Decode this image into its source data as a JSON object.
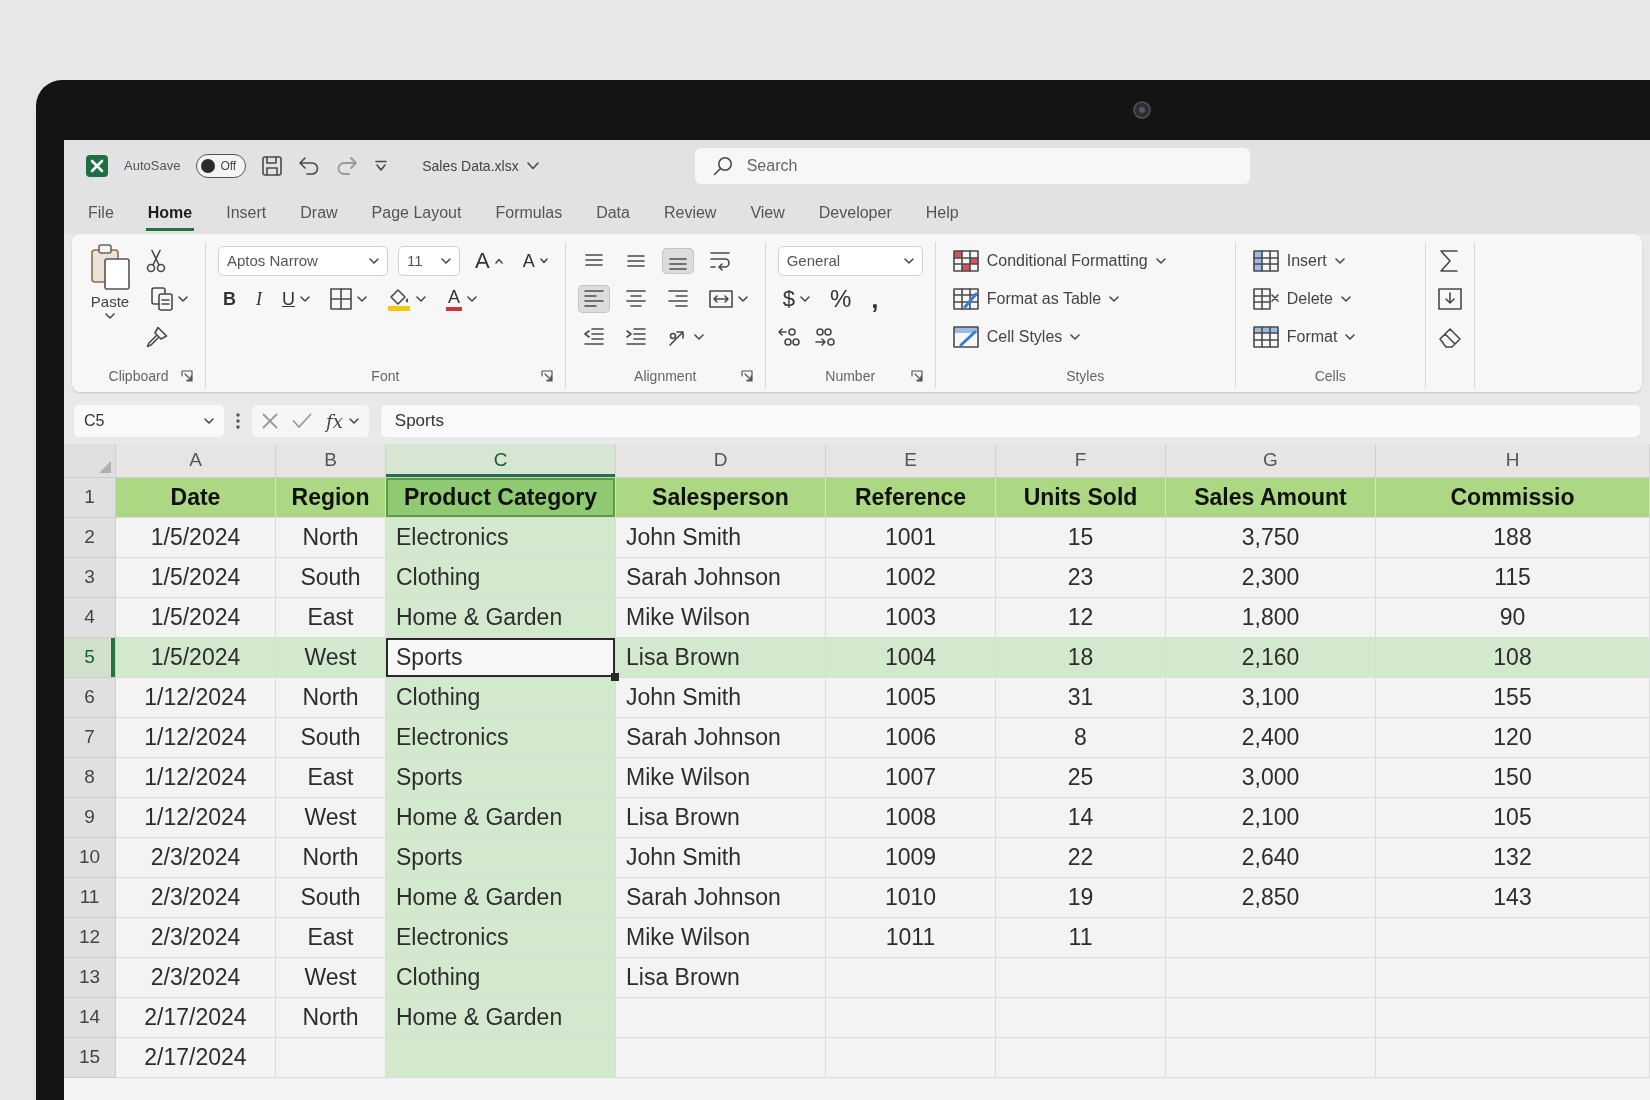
{
  "title_bar": {
    "autosave_label": "AutoSave",
    "autosave": {
      "on": false,
      "label": "Off"
    },
    "file_name": "Sales Data.xlsx",
    "search": {
      "placeholder": "Search"
    }
  },
  "tabs": [
    {
      "label": "File",
      "selected": false
    },
    {
      "label": "Home",
      "selected": true
    },
    {
      "label": "Insert",
      "selected": false
    },
    {
      "label": "Draw",
      "selected": false
    },
    {
      "label": "Page Layout",
      "selected": false
    },
    {
      "label": "Formulas",
      "selected": false
    },
    {
      "label": "Data",
      "selected": false
    },
    {
      "label": "Review",
      "selected": false
    },
    {
      "label": "View",
      "selected": false
    },
    {
      "label": "Developer",
      "selected": false
    },
    {
      "label": "Help",
      "selected": false
    }
  ],
  "ribbon": {
    "clipboard": {
      "label": "Clipboard",
      "paste": "Paste"
    },
    "font": {
      "label": "Font",
      "font_name": "Aptos Narrow",
      "font_size": "11",
      "grow": "A",
      "shrink": "A",
      "bold": "B",
      "italic": "I",
      "underline": "U",
      "font_color": "A"
    },
    "alignment": {
      "label": "Alignment",
      "rows": [
        [
          {
            "kind": "top",
            "selected": false
          },
          {
            "kind": "middle",
            "selected": false
          },
          {
            "kind": "bottom",
            "selected": true
          },
          {
            "kind": "wrap",
            "selected": false
          }
        ],
        [
          {
            "kind": "left",
            "selected": true
          },
          {
            "kind": "center",
            "selected": false
          },
          {
            "kind": "right",
            "selected": false
          },
          {
            "kind": "merge",
            "selected": false
          }
        ],
        [
          {
            "kind": "outdent",
            "selected": false
          },
          {
            "kind": "indent",
            "selected": false
          },
          {
            "kind": "orientation",
            "selected": false
          }
        ]
      ]
    },
    "number": {
      "label": "Number",
      "format": "General",
      "currency": "$",
      "percent": "%",
      "comma": ","
    },
    "styles": {
      "label": "Styles",
      "items": [
        {
          "kind": "conditional",
          "label": "Conditional Formatting"
        },
        {
          "kind": "table",
          "label": "Format as Table"
        },
        {
          "kind": "cell",
          "label": "Cell Styles"
        }
      ]
    },
    "cells": {
      "label": "Cells",
      "items": [
        {
          "kind": "insert",
          "label": "Insert"
        },
        {
          "kind": "delete",
          "label": "Delete"
        },
        {
          "kind": "format",
          "label": "Format"
        }
      ]
    }
  },
  "formula_bar": {
    "name_box": "C5",
    "function_button": "fx",
    "formula": "Sports"
  },
  "sheet": {
    "columns": [
      {
        "letter": "A",
        "selected": false
      },
      {
        "letter": "B",
        "selected": false
      },
      {
        "letter": "C",
        "selected": true
      },
      {
        "letter": "D",
        "selected": false
      },
      {
        "letter": "E",
        "selected": false
      },
      {
        "letter": "F",
        "selected": false
      },
      {
        "letter": "G",
        "selected": false
      },
      {
        "letter": "H",
        "selected": false
      }
    ],
    "rows": [
      {
        "number": "1",
        "kind": "header",
        "selected": false,
        "cells": [
          "Date",
          "Region",
          "Product Category",
          "Salesperson",
          "Reference",
          "Units Sold",
          "Sales Amount",
          "Commissio"
        ]
      },
      {
        "number": "2",
        "kind": "data",
        "selected": false,
        "cells": [
          "1/5/2024",
          "North",
          "Electronics",
          "John Smith",
          "1001",
          "15",
          "3,750",
          "188"
        ]
      },
      {
        "number": "3",
        "kind": "data",
        "selected": false,
        "cells": [
          "1/5/2024",
          "South",
          "Clothing",
          "Sarah Johnson",
          "1002",
          "23",
          "2,300",
          "115"
        ]
      },
      {
        "number": "4",
        "kind": "data",
        "selected": false,
        "cells": [
          "1/5/2024",
          "East",
          "Home & Garden",
          "Mike Wilson",
          "1003",
          "12",
          "1,800",
          "90"
        ]
      },
      {
        "number": "5",
        "kind": "data",
        "selected": true,
        "cells": [
          "1/5/2024",
          "West",
          "Sports",
          "Lisa Brown",
          "1004",
          "18",
          "2,160",
          "108"
        ]
      },
      {
        "number": "6",
        "kind": "data",
        "selected": false,
        "cells": [
          "1/12/2024",
          "North",
          "Clothing",
          "John Smith",
          "1005",
          "31",
          "3,100",
          "155"
        ]
      },
      {
        "number": "7",
        "kind": "data",
        "selected": false,
        "cells": [
          "1/12/2024",
          "South",
          "Electronics",
          "Sarah Johnson",
          "1006",
          "8",
          "2,400",
          "120"
        ]
      },
      {
        "number": "8",
        "kind": "data",
        "selected": false,
        "cells": [
          "1/12/2024",
          "East",
          "Sports",
          "Mike Wilson",
          "1007",
          "25",
          "3,000",
          "150"
        ]
      },
      {
        "number": "9",
        "kind": "data",
        "selected": false,
        "cells": [
          "1/12/2024",
          "West",
          "Home & Garden",
          "Lisa Brown",
          "1008",
          "14",
          "2,100",
          "105"
        ]
      },
      {
        "number": "10",
        "kind": "data",
        "selected": false,
        "cells": [
          "2/3/2024",
          "North",
          "Sports",
          "John Smith",
          "1009",
          "22",
          "2,640",
          "132"
        ]
      },
      {
        "number": "11",
        "kind": "data",
        "selected": false,
        "cells": [
          "2/3/2024",
          "South",
          "Home & Garden",
          "Sarah Johnson",
          "1010",
          "19",
          "2,850",
          "143"
        ]
      },
      {
        "number": "12",
        "kind": "data",
        "selected": false,
        "cells": [
          "2/3/2024",
          "East",
          "Electronics",
          "Mike Wilson",
          "1011",
          "11"
        ]
      },
      {
        "number": "13",
        "kind": "data",
        "selected": false,
        "cells": [
          "2/3/2024",
          "West",
          "Clothing",
          "Lisa Brown"
        ]
      },
      {
        "number": "14",
        "kind": "data",
        "selected": false,
        "cells": [
          "2/17/2024",
          "North",
          "Home & Garden"
        ]
      },
      {
        "number": "15",
        "kind": "data",
        "selected": false,
        "cells": [
          "2/17/2024"
        ]
      }
    ]
  }
}
